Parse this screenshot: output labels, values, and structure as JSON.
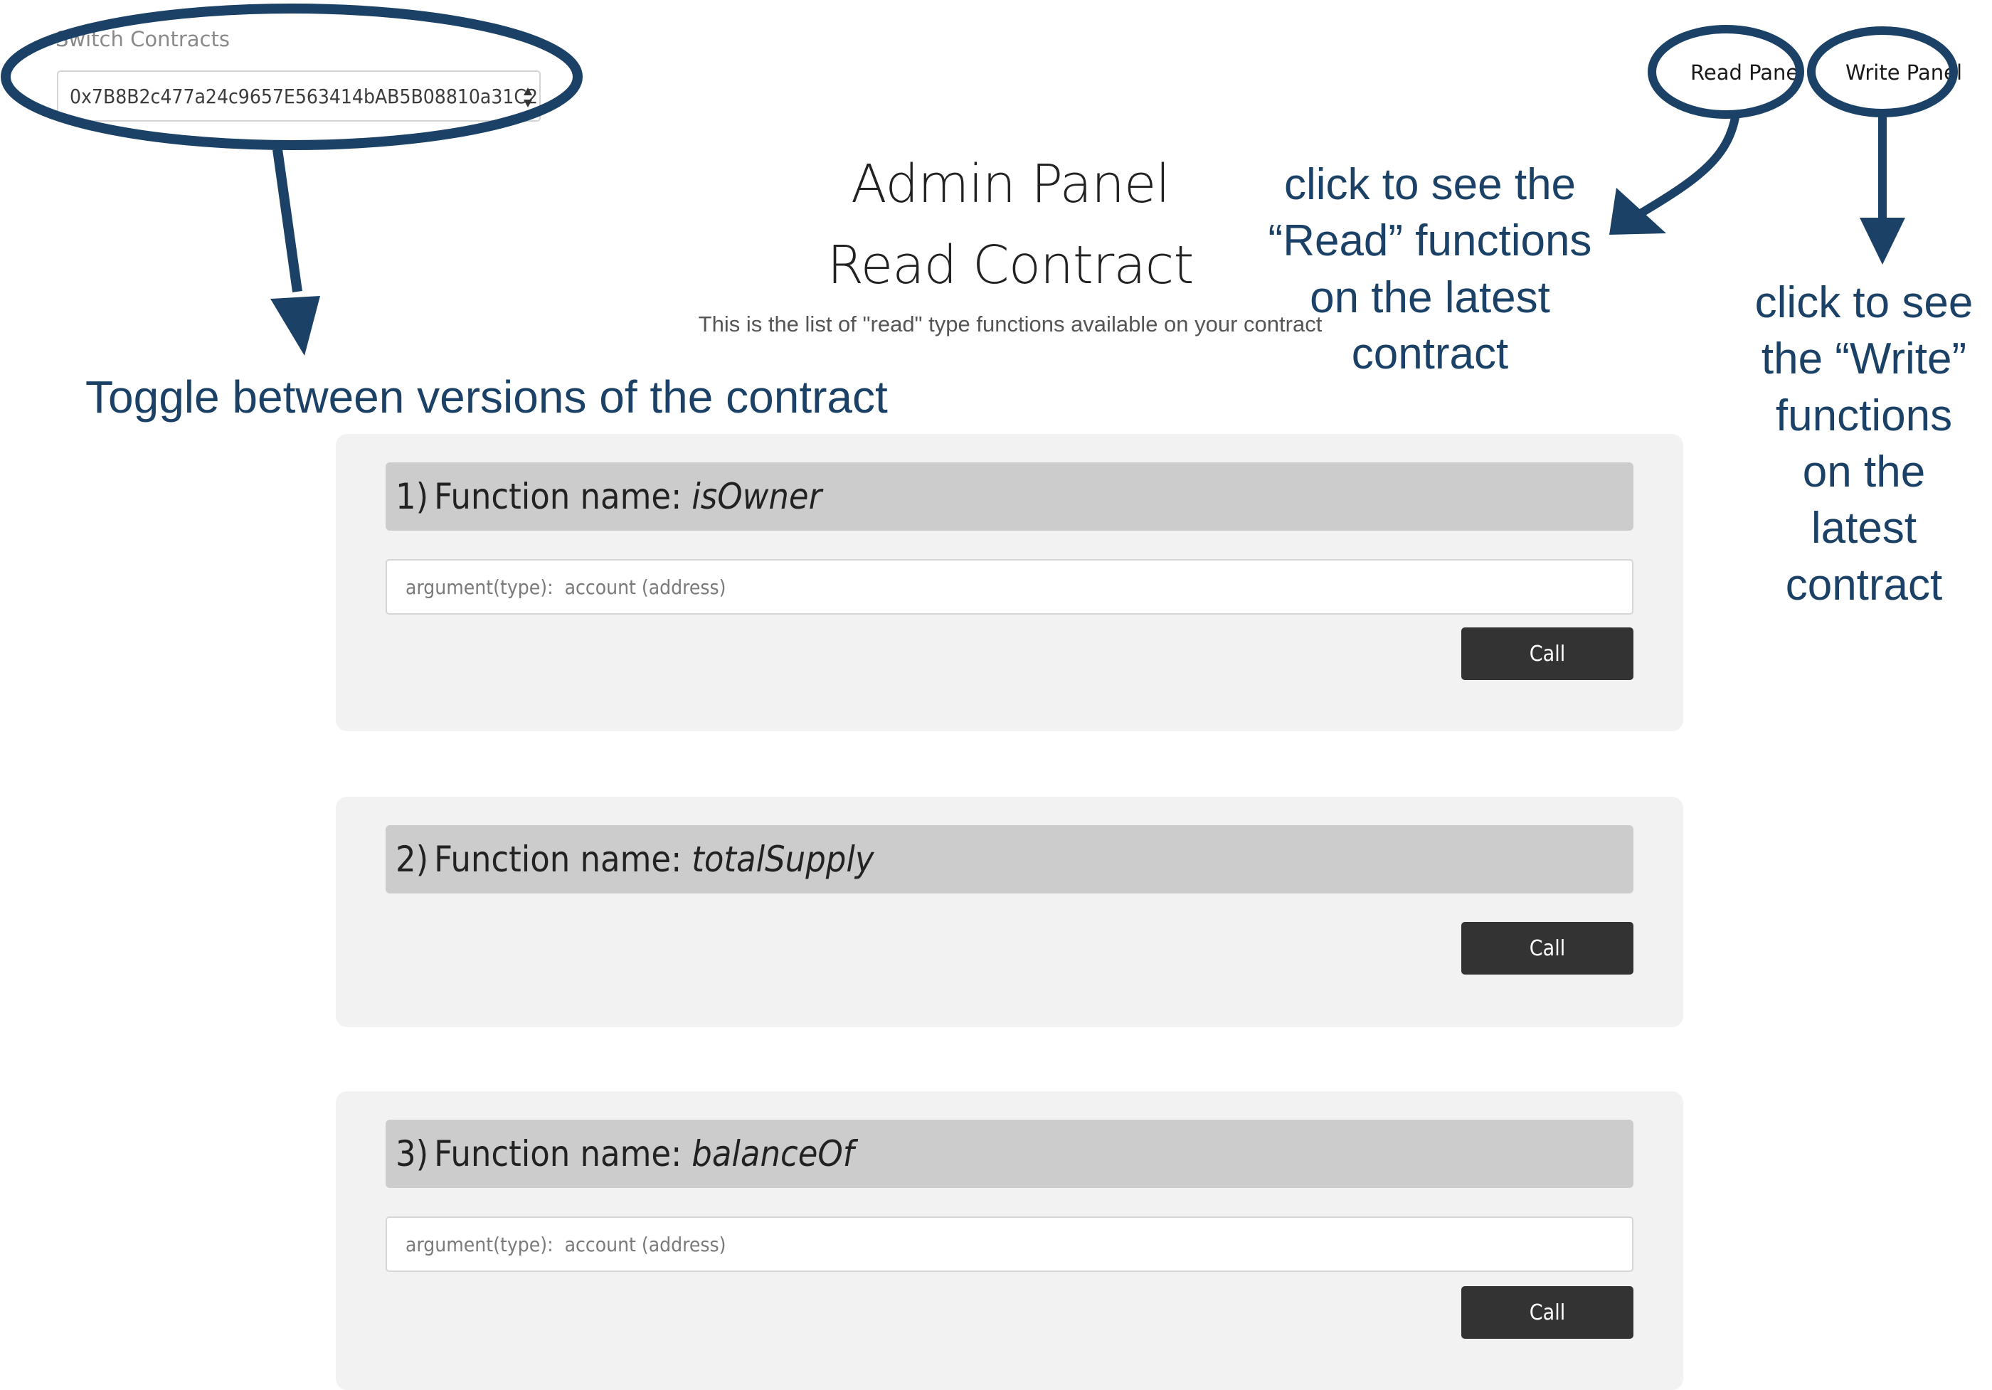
{
  "switch_contracts": {
    "label": "Switch Contracts",
    "selected_address": "0x7B8B2c477a24c9657E563414bAB5B08810a31C27"
  },
  "nav": {
    "read_panel": "Read Panel",
    "write_panel": "Write Panel"
  },
  "header": {
    "title": "Admin Panel",
    "subtitle": "Read Contract",
    "description": "This is the list of \"read\" type functions available on your contract"
  },
  "functions": [
    {
      "number": "1)",
      "prefix": "Function name:",
      "name": "isOwner",
      "argument_placeholder": "argument(type):  account (address)",
      "button": "Call"
    },
    {
      "number": "2)",
      "prefix": "Function name:",
      "name": "totalSupply",
      "button": "Call"
    },
    {
      "number": "3)",
      "prefix": "Function name:",
      "name": "balanceOf",
      "argument_placeholder": "argument(type):  account (address)",
      "button": "Call"
    }
  ],
  "annotations": {
    "toggle": "Toggle between versions of the contract",
    "read_lines": [
      "click to see the",
      "“Read” functions",
      "on the latest",
      "contract"
    ],
    "write_lines": [
      "click to see",
      "the “Write”",
      "functions",
      "on the",
      "latest",
      "contract"
    ],
    "color": "#1b4266"
  },
  "colors": {
    "card_bg": "#f2f2f2",
    "header_bg": "#cccccc",
    "button_bg": "#333333"
  }
}
